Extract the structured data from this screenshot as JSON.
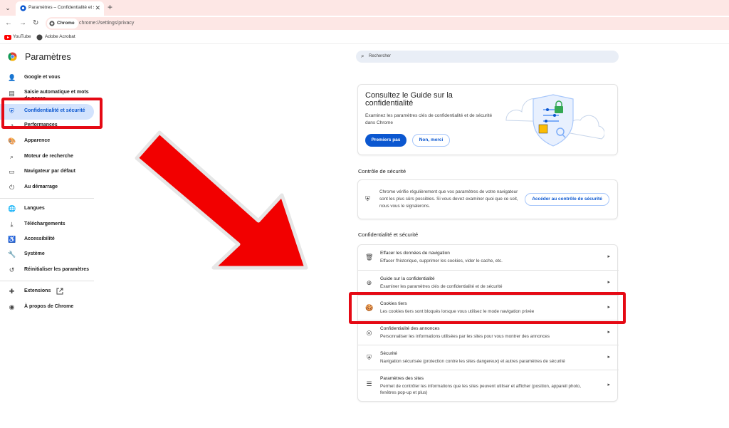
{
  "browser": {
    "tab_title": "Paramètres – Confidentialité et sécurité",
    "tab_close": "✕",
    "new_tab": "+",
    "tab_menu": "⌄",
    "chip": "Chrome",
    "url": "chrome://settings/privacy",
    "bookmarks": [
      "YouTube",
      "Adobe Acrobat"
    ],
    "back": "←",
    "forward": "→",
    "reload": "↻"
  },
  "sidebar": {
    "title": "Paramètres",
    "items": [
      {
        "label": "Google et vous",
        "icon": "person-icon",
        "glyph": "👤"
      },
      {
        "label": "Saisie automatique et mots de passe",
        "icon": "clipboard-icon",
        "glyph": "▤"
      },
      {
        "label": "Confidentialité et sécurité",
        "icon": "shield-icon",
        "glyph": "⛨"
      },
      {
        "label": "Performances",
        "icon": "speedometer-icon",
        "glyph": "◔"
      },
      {
        "label": "Apparence",
        "icon": "palette-icon",
        "glyph": "🎨"
      },
      {
        "label": "Moteur de recherche",
        "icon": "search-icon",
        "glyph": "⌕"
      },
      {
        "label": "Navigateur par défaut",
        "icon": "browser-icon",
        "glyph": "▭"
      },
      {
        "label": "Au démarrage",
        "icon": "power-icon",
        "glyph": "⏻"
      },
      {
        "label": "Langues",
        "icon": "globe-icon",
        "glyph": "🌐"
      },
      {
        "label": "Téléchargements",
        "icon": "download-icon",
        "glyph": "⤓"
      },
      {
        "label": "Accessibilité",
        "icon": "accessibility-icon",
        "glyph": "♿"
      },
      {
        "label": "Système",
        "icon": "wrench-icon",
        "glyph": "🔧"
      },
      {
        "label": "Réinitialiser les paramètres",
        "icon": "reset-icon",
        "glyph": "↺"
      },
      {
        "label": "Extensions",
        "icon": "puzzle-icon",
        "glyph": "✚"
      },
      {
        "label": "À propos de Chrome",
        "icon": "chrome-icon",
        "glyph": "◉"
      }
    ]
  },
  "search": {
    "placeholder": "Rechercher",
    "icon": "search-icon"
  },
  "guide_card": {
    "title": "Consultez le Guide sur la confidentialité",
    "description": "Examinez les paramètres clés de confidentialité et de sécurité dans Chrome",
    "primary_button": "Premiers pas",
    "secondary_button": "Non, merci"
  },
  "safety_check": {
    "section_title": "Contrôle de sécurité",
    "text": "Chrome vérifie régulièrement que vos paramètres de votre navigateur sont les plus sûrs possibles. Si vous devez examiner quoi que ce soit, nous vous le signalerons.",
    "button": "Accéder au contrôle de sécurité"
  },
  "privacy": {
    "section_title": "Confidentialité et sécurité",
    "rows": [
      {
        "title": "Effacer les données de navigation",
        "desc": "Effacer l'historique, supprimer les cookies, vider le cache, etc.",
        "icon": "trash-icon",
        "glyph": "🗑"
      },
      {
        "title": "Guide sur la confidentialité",
        "desc": "Examiner les paramètres clés de confidentialité et de sécurité",
        "icon": "compass-icon",
        "glyph": "⊕"
      },
      {
        "title": "Cookies tiers",
        "desc": "Les cookies tiers sont bloqués lorsque vous utilisez le mode navigation privée",
        "icon": "cookie-icon",
        "glyph": "🍪"
      },
      {
        "title": "Confidentialité des annonces",
        "desc": "Personnaliser les informations utilisées par les sites pour vous montrer des annonces",
        "icon": "ad-privacy-icon",
        "glyph": "◎"
      },
      {
        "title": "Sécurité",
        "desc": "Navigation sécurisée (protection contre les sites dangereux) et autres paramètres de sécurité",
        "icon": "shield-icon",
        "glyph": "⛨"
      },
      {
        "title": "Paramètres des sites",
        "desc": "Permet de contrôler les informations que les sites peuvent utiliser et afficher (position, appareil photo, fenêtres pop-up et plus)",
        "icon": "sliders-icon",
        "glyph": "☰"
      }
    ],
    "chevron": "▸"
  },
  "colors": {
    "accent": "#0b57d0",
    "highlight": "#e50914",
    "tabstrip": "#fde7e5",
    "active_bg": "#d3e3fd"
  }
}
